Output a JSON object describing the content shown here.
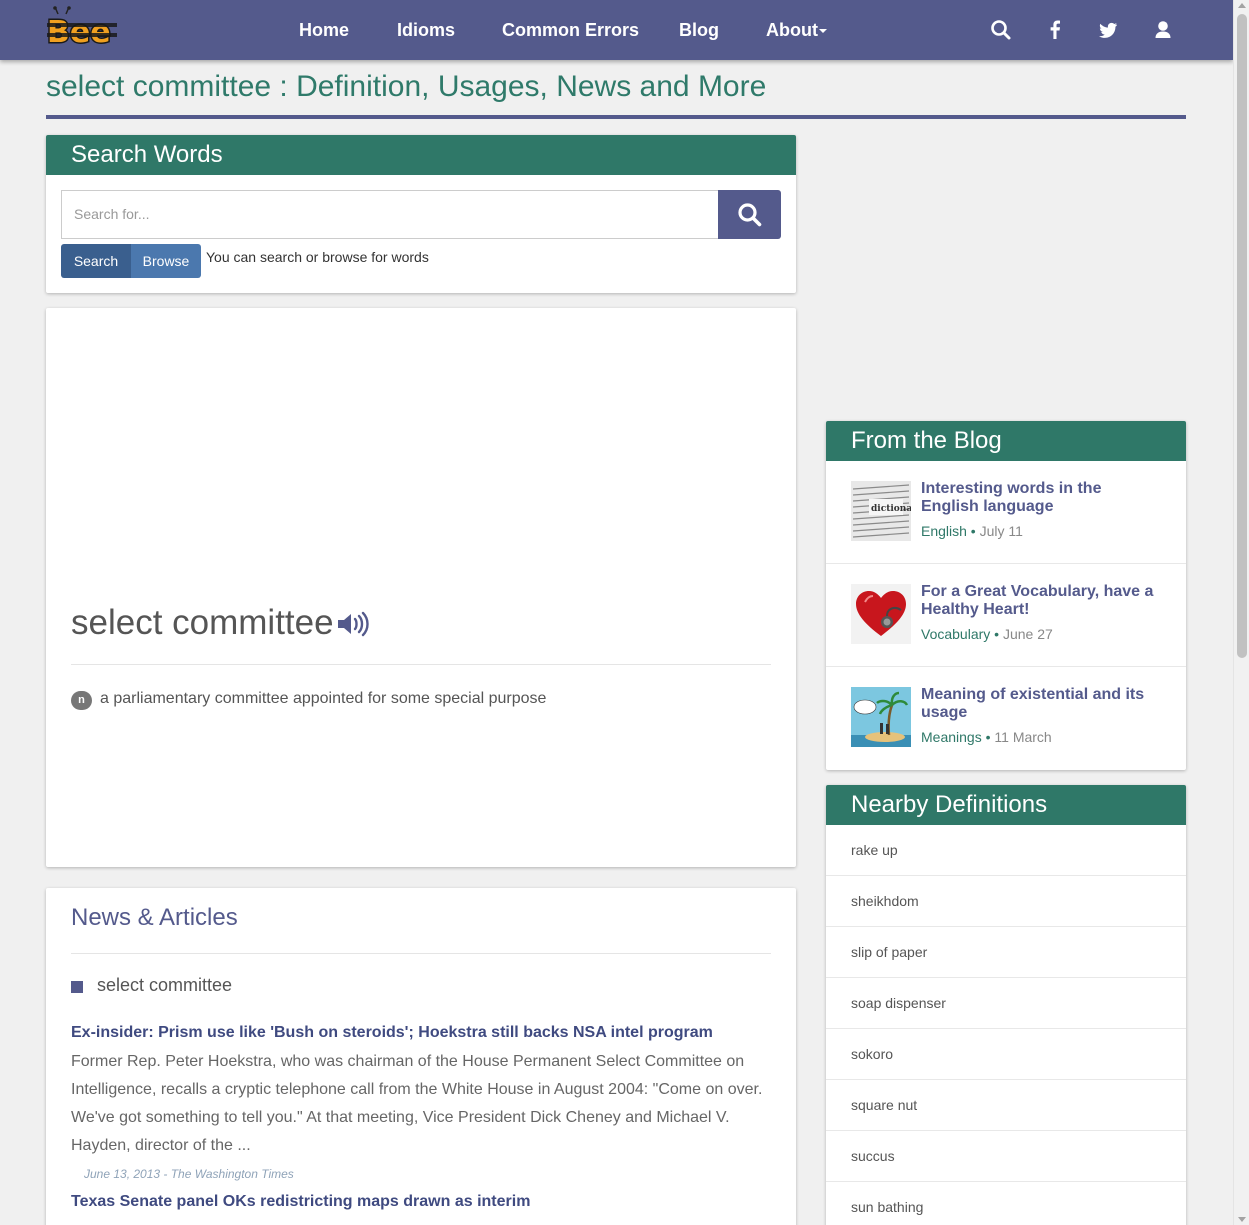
{
  "nav": {
    "logo_text": "Bee",
    "items": [
      "Home",
      "Idioms",
      "Common Errors",
      "Blog",
      "About"
    ],
    "icons": [
      "search-icon",
      "facebook-icon",
      "twitter-icon",
      "user-icon"
    ]
  },
  "page": {
    "title": "select committee : Definition, Usages, News and More"
  },
  "search": {
    "heading": "Search Words",
    "placeholder": "Search for...",
    "search_tab": "Search",
    "browse_tab": "Browse",
    "hint": "You can search or browse for words"
  },
  "definition": {
    "word": "select committee",
    "pos": "n",
    "text": "a parliamentary committee appointed for some special purpose"
  },
  "news": {
    "heading": "News & Articles",
    "tag": "select committee",
    "articles": [
      {
        "title": "Ex-insider: Prism use like 'Bush on steroids'; Hoekstra still backs NSA intel program",
        "body": "Former Rep. Peter Hoekstra, who was chairman of the House Permanent Select Committee on Intelligence, recalls a cryptic telephone call from the White House in August 2004: \"Come on over. We've got something to tell you.\" At that meeting, Vice President Dick Cheney and Michael V. Hayden, director of the ...",
        "meta": "June 13, 2013 - The Washington Times"
      },
      {
        "title": "Texas Senate panel OKs redistricting maps drawn as interim"
      }
    ]
  },
  "blog": {
    "heading": "From the Blog",
    "posts": [
      {
        "title": "Interesting words in the English language",
        "category": "English",
        "date": "July 11"
      },
      {
        "title": "For a Great Vocabulary, have a Healthy Heart!",
        "category": "Vocabulary",
        "date": "June 27"
      },
      {
        "title": "Meaning of existential and its usage",
        "category": "Meanings",
        "date": "11 March"
      }
    ]
  },
  "nearby": {
    "heading": "Nearby Definitions",
    "items": [
      "rake up",
      "sheikhdom",
      "slip of paper",
      "soap dispenser",
      "sokoro",
      "square nut",
      "succus",
      "sun bathing"
    ]
  },
  "colors": {
    "nav_bg": "#545a8c",
    "card_header": "#2f7868",
    "title_green": "#2f7a6a",
    "link_blue": "#3f4a80"
  }
}
